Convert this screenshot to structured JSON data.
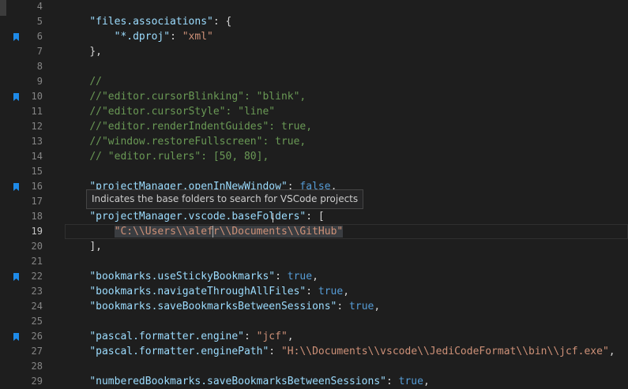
{
  "tooltip_text": "Indicates the base folders to search for VSCode projects",
  "lines": [
    {
      "n": "4",
      "bookmark": false,
      "tokens": []
    },
    {
      "n": "5",
      "bookmark": false,
      "tokens": [
        {
          "t": "    "
        },
        {
          "t": "\"files.associations\"",
          "c": "key"
        },
        {
          "t": ": {",
          "c": "punc"
        }
      ]
    },
    {
      "n": "6",
      "bookmark": true,
      "tokens": [
        {
          "t": "        "
        },
        {
          "t": "\"*.dproj\"",
          "c": "key"
        },
        {
          "t": ": ",
          "c": "punc"
        },
        {
          "t": "\"xml\"",
          "c": "str"
        }
      ]
    },
    {
      "n": "7",
      "bookmark": false,
      "tokens": [
        {
          "t": "    "
        },
        {
          "t": "},",
          "c": "punc"
        }
      ]
    },
    {
      "n": "8",
      "bookmark": false,
      "tokens": []
    },
    {
      "n": "9",
      "bookmark": false,
      "tokens": [
        {
          "t": "    "
        },
        {
          "t": "//",
          "c": "comment"
        }
      ]
    },
    {
      "n": "10",
      "bookmark": true,
      "tokens": [
        {
          "t": "    "
        },
        {
          "t": "//\"editor.cursorBlinking\": \"blink\",",
          "c": "comment"
        }
      ]
    },
    {
      "n": "11",
      "bookmark": false,
      "tokens": [
        {
          "t": "    "
        },
        {
          "t": "//\"editor.cursorStyle\": \"line\"",
          "c": "comment"
        }
      ]
    },
    {
      "n": "12",
      "bookmark": false,
      "tokens": [
        {
          "t": "    "
        },
        {
          "t": "//\"editor.renderIndentGuides\": true,",
          "c": "comment"
        }
      ]
    },
    {
      "n": "13",
      "bookmark": false,
      "tokens": [
        {
          "t": "    "
        },
        {
          "t": "//\"window.restoreFullscreen\": true,",
          "c": "comment"
        }
      ]
    },
    {
      "n": "14",
      "bookmark": false,
      "tokens": [
        {
          "t": "    "
        },
        {
          "t": "// \"editor.rulers\": [50, 80],",
          "c": "comment"
        }
      ]
    },
    {
      "n": "15",
      "bookmark": false,
      "tokens": []
    },
    {
      "n": "16",
      "bookmark": true,
      "tokens": [
        {
          "t": "    "
        },
        {
          "t": "\"projectManager.openInNewWindow\"",
          "c": "key"
        },
        {
          "t": ": ",
          "c": "punc"
        },
        {
          "t": "false",
          "c": "bool"
        },
        {
          "t": ",",
          "c": "punc"
        }
      ]
    },
    {
      "n": "17",
      "bookmark": false,
      "tokens": []
    },
    {
      "n": "18",
      "bookmark": false,
      "tokens": [
        {
          "t": "    "
        },
        {
          "t": "\"projectManager.vscode.baseFolders\"",
          "c": "key"
        },
        {
          "t": ": [",
          "c": "punc"
        }
      ]
    },
    {
      "n": "19",
      "bookmark": false,
      "current": true,
      "tokens": [
        {
          "t": "        "
        },
        {
          "t": "\"C:\\\\Users\\\\alef",
          "c": "str sel"
        },
        {
          "t": "",
          "c": "cursor"
        },
        {
          "t": "r\\\\Documents\\\\GitHub\"",
          "c": "str sel"
        }
      ]
    },
    {
      "n": "20",
      "bookmark": false,
      "tokens": [
        {
          "t": "    "
        },
        {
          "t": "],",
          "c": "punc"
        }
      ]
    },
    {
      "n": "21",
      "bookmark": false,
      "tokens": []
    },
    {
      "n": "22",
      "bookmark": true,
      "tokens": [
        {
          "t": "    "
        },
        {
          "t": "\"bookmarks.useStickyBookmarks\"",
          "c": "key"
        },
        {
          "t": ": ",
          "c": "punc"
        },
        {
          "t": "true",
          "c": "bool"
        },
        {
          "t": ",",
          "c": "punc"
        }
      ]
    },
    {
      "n": "23",
      "bookmark": false,
      "tokens": [
        {
          "t": "    "
        },
        {
          "t": "\"bookmarks.navigateThroughAllFiles\"",
          "c": "key"
        },
        {
          "t": ": ",
          "c": "punc"
        },
        {
          "t": "true",
          "c": "bool"
        },
        {
          "t": ",",
          "c": "punc"
        }
      ]
    },
    {
      "n": "24",
      "bookmark": false,
      "tokens": [
        {
          "t": "    "
        },
        {
          "t": "\"bookmarks.saveBookmarksBetweenSessions\"",
          "c": "key"
        },
        {
          "t": ": ",
          "c": "punc"
        },
        {
          "t": "true",
          "c": "bool"
        },
        {
          "t": ",",
          "c": "punc"
        }
      ]
    },
    {
      "n": "25",
      "bookmark": false,
      "tokens": []
    },
    {
      "n": "26",
      "bookmark": true,
      "tokens": [
        {
          "t": "    "
        },
        {
          "t": "\"pascal.formatter.engine\"",
          "c": "key"
        },
        {
          "t": ": ",
          "c": "punc"
        },
        {
          "t": "\"jcf\"",
          "c": "str"
        },
        {
          "t": ",",
          "c": "punc"
        }
      ]
    },
    {
      "n": "27",
      "bookmark": false,
      "tokens": [
        {
          "t": "    "
        },
        {
          "t": "\"pascal.formatter.enginePath\"",
          "c": "key"
        },
        {
          "t": ": ",
          "c": "punc"
        },
        {
          "t": "\"H:\\\\Documents\\\\vscode\\\\JediCodeFormat\\\\bin\\\\jcf.exe\"",
          "c": "str"
        },
        {
          "t": ",",
          "c": "punc"
        }
      ]
    },
    {
      "n": "28",
      "bookmark": false,
      "tokens": []
    },
    {
      "n": "29",
      "bookmark": false,
      "tokens": [
        {
          "t": "    "
        },
        {
          "t": "\"numberedBookmarks.saveBookmarksBetweenSessions\"",
          "c": "key"
        },
        {
          "t": ": ",
          "c": "punc"
        },
        {
          "t": "true",
          "c": "bool"
        },
        {
          "t": ",",
          "c": "punc"
        }
      ]
    }
  ]
}
